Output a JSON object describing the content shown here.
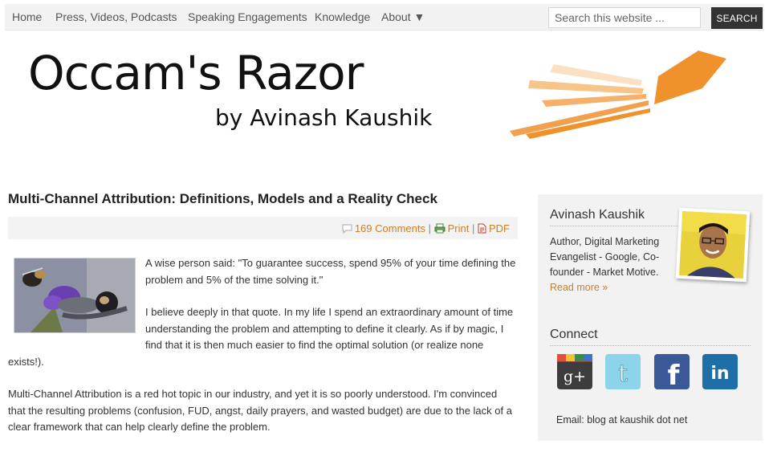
{
  "nav": {
    "items": [
      {
        "label": "Home"
      },
      {
        "label": "Press, Videos, Podcasts"
      },
      {
        "label": "Speaking Engagements"
      },
      {
        "label": "Knowledge"
      },
      {
        "label": "About ▼"
      }
    ],
    "search_placeholder": "Search this website ...",
    "search_button": "SEARCH"
  },
  "header": {
    "title": "Occam's Razor",
    "subtitle": "by Avinash Kaushik",
    "accent_color": "#f0922b"
  },
  "post": {
    "title": "Multi-Channel Attribution: Definitions, Models and a Reality Check",
    "comments": "169 Comments",
    "print": "Print",
    "pdf": "PDF",
    "separator": "|",
    "paragraphs": [
      "A wise person said: \"To guarantee success, spend 95% of your time defining the problem and 5% of the time solving it.\"",
      "I believe deeply in that quote. In my life I spend an extraordinary amount of time understanding the problem and attempting to define it clearly. As if by magic, I find that it is then much easier to find the optimal solution (or realize none exists!).",
      "Multi-Channel Attribution is a red hot topic in our industry, and yet it is so poorly understood. I'm convinced that the resulting problems (confusion, FUD, angst, daily prayers, and wasted budget) are due to the lack of a clear framework that can help clearly define the problem."
    ]
  },
  "sidebar": {
    "name": "Avinash Kaushik",
    "bio": "Author, Digital Marketing Evangelist - Google, Co-founder - Market Motive.",
    "read_more": "Read more »",
    "connect": "Connect",
    "social": [
      {
        "icon": "google-plus-icon",
        "glyph": "g+",
        "color": "#2b2b2b"
      },
      {
        "icon": "twitter-icon",
        "glyph": "t",
        "color": "#8dd4ea"
      },
      {
        "icon": "facebook-icon",
        "glyph": "f",
        "color": "#3b5998"
      },
      {
        "icon": "linkedin-icon",
        "glyph": "in",
        "color": "#1e6fa8"
      }
    ],
    "email": "Email: blog at kaushik dot net"
  }
}
